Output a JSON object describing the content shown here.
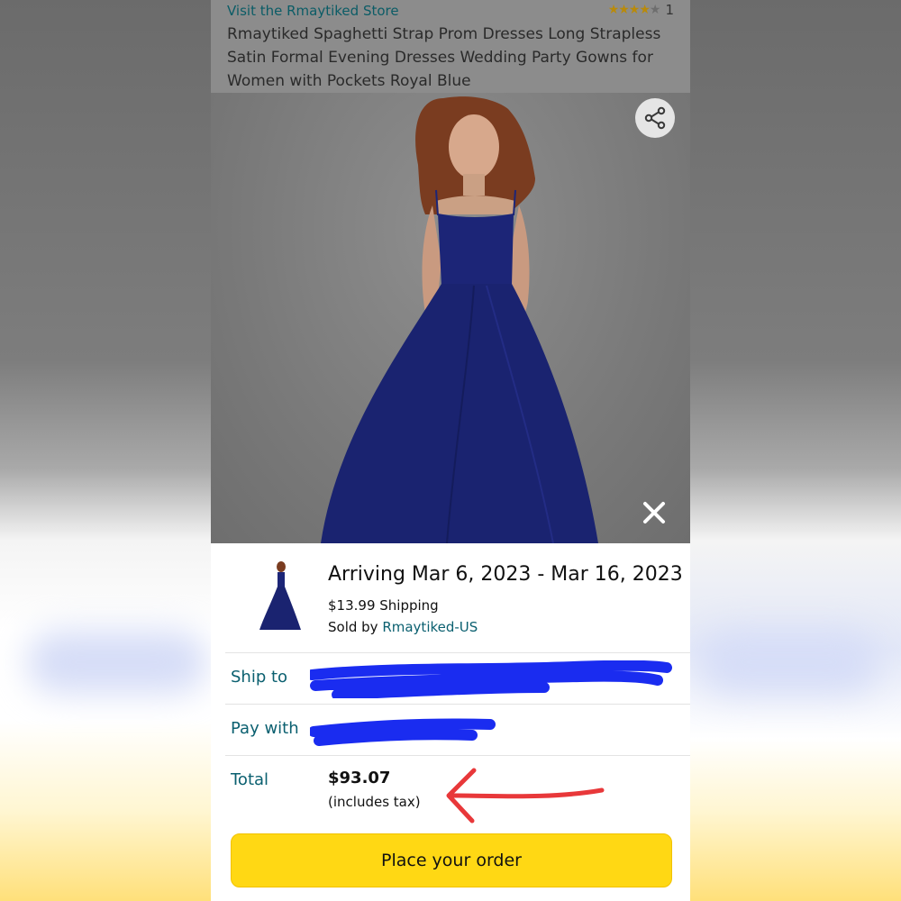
{
  "header": {
    "store_link": "Visit the Rmaytiked Store",
    "rating_count": "1",
    "stars_filled": 4,
    "stars_total": 5,
    "product_title": "Rmaytiked Spaghetti Strap Prom Dresses Long Strapless Satin Formal Evening Dresses Wedding Party Gowns for Women with Pockets Royal Blue"
  },
  "icons": {
    "share": "share-icon",
    "close": "close-icon"
  },
  "summary": {
    "arriving": "Arriving Mar 6, 2023 - Mar 16, 2023",
    "shipping": "$13.99 Shipping",
    "sold_by_prefix": "Sold by ",
    "seller": "Rmaytiked-US"
  },
  "checkout": {
    "ship_to_label": "Ship to",
    "pay_with_label": "Pay with",
    "total_label": "Total",
    "total_amount": "$93.07",
    "total_note": "(includes tax)",
    "place_order": "Place your order"
  },
  "colors": {
    "link": "#0b6070",
    "button": "#ffd814",
    "redaction": "#1a2cf0",
    "annotation": "#e8383a",
    "dress": "#1c2577"
  }
}
